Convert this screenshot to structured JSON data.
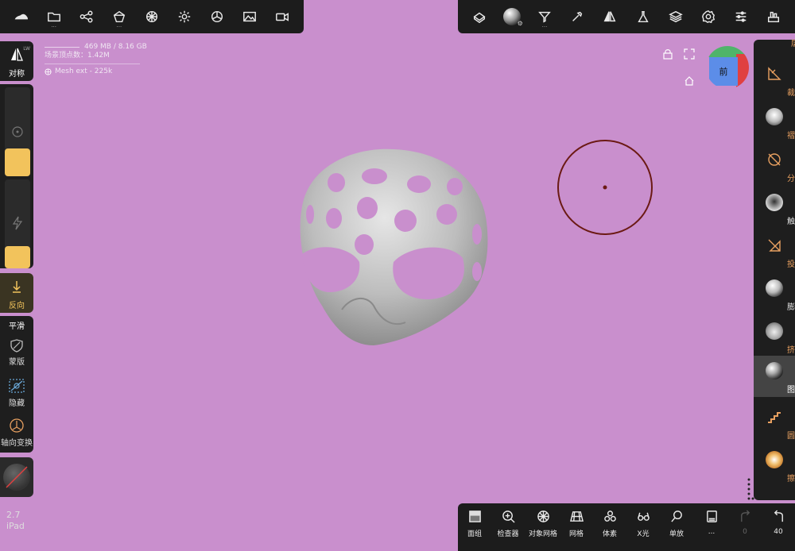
{
  "top_left_toolbar": {
    "items": [
      "cloud-icon",
      "folder-icon",
      "share-icon",
      "scene-icon",
      "mesh-icon",
      "light-icon",
      "material-icon",
      "image-icon",
      "video-icon"
    ]
  },
  "top_right_toolbar": {
    "items": [
      "gizmo-icon",
      "matcap-icon",
      "filter-icon",
      "picker-icon",
      "symmetry-icon",
      "flask-icon",
      "layers-icon",
      "settings-icon",
      "sliders-icon",
      "tools-icon"
    ]
  },
  "left_panel": {
    "symmetry_label": "对称",
    "symmetry_badge": "LW",
    "reverse_label": "反向",
    "smooth_label": "平滑",
    "mask_label": "蒙版",
    "hide_label": "隐藏",
    "axis_label": "轴向变换",
    "radius_fill": 0.45,
    "intensity_fill": 0.25
  },
  "stats": {
    "memory": "469 MB / 8.16 GB",
    "vertices": "场景顶点数：1.42M",
    "mesh": "Mesh ext - 225k"
  },
  "version": {
    "number": "2.7",
    "device": "iPad"
  },
  "view_cube": {
    "face": "前"
  },
  "right_tools": [
    {
      "label": "层",
      "icon": "layer-icon"
    },
    {
      "label": "裁切",
      "icon": "trim-icon"
    },
    {
      "label": "褶皱",
      "icon": "crease-icon"
    },
    {
      "label": "分割",
      "icon": "split-icon"
    },
    {
      "label": "触碰",
      "icon": "tap-icon"
    },
    {
      "label": "投射",
      "icon": "project-icon"
    },
    {
      "label": "膨胀",
      "icon": "inflate-icon"
    },
    {
      "label": "挤捏",
      "icon": "pinch-icon"
    },
    {
      "label": "图章",
      "icon": "stamp-icon"
    },
    {
      "label": "圆管",
      "icon": "tube-icon"
    },
    {
      "label": "擦除",
      "icon": "erase-icon"
    }
  ],
  "bottom_toolbar": [
    {
      "label": "面组",
      "icon": "facegroup-icon"
    },
    {
      "label": "检查器",
      "icon": "inspector-icon"
    },
    {
      "label": "对象网格",
      "icon": "object-grid-icon"
    },
    {
      "label": "网格",
      "icon": "grid-icon"
    },
    {
      "label": "体素",
      "icon": "voxel-icon"
    },
    {
      "label": "X光",
      "icon": "xray-icon"
    },
    {
      "label": "单放",
      "icon": "isolate-icon"
    },
    {
      "label": "...",
      "icon": "more-icon"
    },
    {
      "label": "0",
      "icon": "redo-icon"
    },
    {
      "label": "40",
      "icon": "undo-icon"
    }
  ],
  "colors": {
    "background": "#c98fcd",
    "accent": "#f2c35c",
    "tool_accent": "#e8a060",
    "panel": "#1e1e1e"
  }
}
